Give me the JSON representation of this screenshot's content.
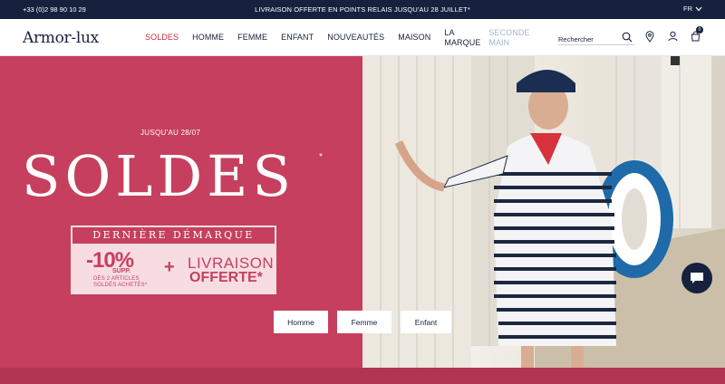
{
  "topbar": {
    "phone": "+33 (0)2 98 90 10 29",
    "promo": "LIVRAISON OFFERTE EN POINTS RELAIS JUSQU'AU 28 JUILLET*",
    "language": "FR"
  },
  "header": {
    "logo": "Armor-lux",
    "nav": [
      {
        "label": "SOLDES"
      },
      {
        "label": "HOMME"
      },
      {
        "label": "FEMME"
      },
      {
        "label": "ENFANT"
      },
      {
        "label": "NOUVEAUTÉS"
      },
      {
        "label": "MAISON"
      },
      {
        "label_line1": "LA",
        "label_line2": "MARQUE"
      },
      {
        "label_line1": "SECONDE",
        "label_line2": "MAIN"
      }
    ],
    "search_placeholder": "Rechercher",
    "cart_count": "0",
    "icons": [
      "search-icon",
      "store-locator-icon",
      "account-icon",
      "cart-icon"
    ]
  },
  "hero": {
    "until": "JUSQU'AU 28/07",
    "title": "SOLDES",
    "title_mark": "*",
    "promo_head": "DERNIÈRE DÉMARQUE",
    "discount": "-10%",
    "discount_suffix": "SUPP.",
    "condition_line1": "DÈS 2 ARTICLES",
    "condition_line2": "SOLDÉS ACHETÉS*",
    "plus": "+",
    "delivery_line1": "LIVRAISON",
    "delivery_line2": "OFFERTE*",
    "buttons": [
      "Homme",
      "Femme",
      "Enfant"
    ]
  },
  "colors": {
    "navy": "#15213d",
    "hero_pink": "#c63f5f",
    "promo_bg": "#f7dde2",
    "active_nav": "#c8283f",
    "muted_nav": "#9fb6d6"
  }
}
